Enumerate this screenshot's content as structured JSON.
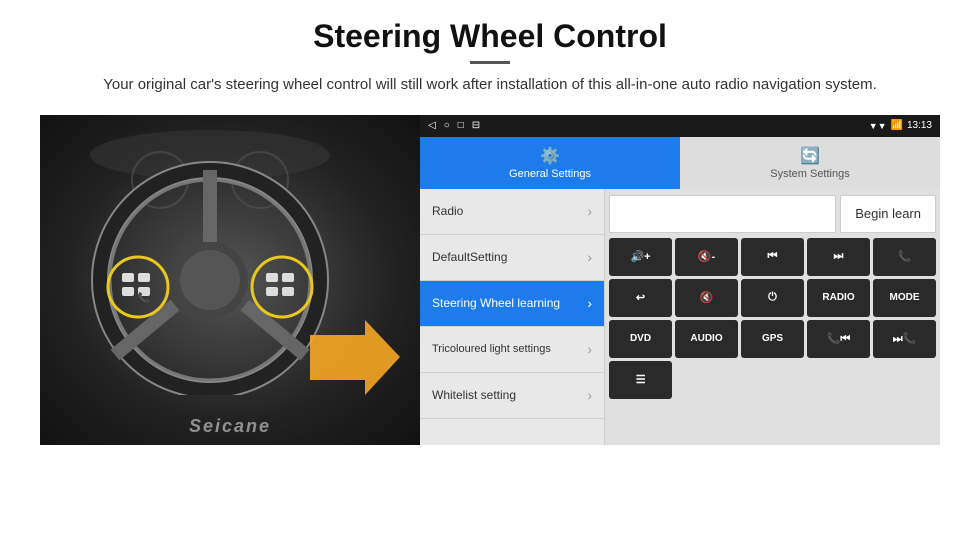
{
  "page": {
    "title": "Steering Wheel Control",
    "subtitle": "Your original car's steering wheel control will still work after installation of this all-in-one auto radio navigation system."
  },
  "status_bar": {
    "nav_back": "◁",
    "nav_home": "○",
    "nav_square": "□",
    "nav_menu": "⊟",
    "signal": "▼▼",
    "wifi": "wifi",
    "time": "13:13"
  },
  "tabs": [
    {
      "id": "general",
      "label": "General Settings",
      "active": true
    },
    {
      "id": "system",
      "label": "System Settings",
      "active": false
    }
  ],
  "menu_items": [
    {
      "id": "radio",
      "label": "Radio",
      "active": false
    },
    {
      "id": "default",
      "label": "DefaultSetting",
      "active": false
    },
    {
      "id": "steering",
      "label": "Steering Wheel learning",
      "active": true
    },
    {
      "id": "tricoloured",
      "label": "Tricoloured light settings",
      "active": false
    },
    {
      "id": "whitelist",
      "label": "Whitelist setting",
      "active": false
    }
  ],
  "controls": {
    "begin_learn_label": "Begin learn",
    "buttons_row1": [
      {
        "id": "vol-up",
        "label": "🔊+",
        "symbol": "🔊+"
      },
      {
        "id": "vol-down",
        "label": "🔇-",
        "symbol": "🔇-"
      },
      {
        "id": "prev",
        "label": "⏮",
        "symbol": "⏮"
      },
      {
        "id": "next",
        "label": "⏭",
        "symbol": "⏭"
      },
      {
        "id": "phone",
        "label": "📞",
        "symbol": "📞"
      }
    ],
    "buttons_row2": [
      {
        "id": "hang-up",
        "label": "↩",
        "symbol": "↩"
      },
      {
        "id": "mute",
        "label": "🔇x",
        "symbol": "🔇"
      },
      {
        "id": "power",
        "label": "⏻",
        "symbol": "⏻"
      },
      {
        "id": "radio",
        "label": "RADIO",
        "symbol": "RADIO"
      },
      {
        "id": "mode",
        "label": "MODE",
        "symbol": "MODE"
      }
    ],
    "buttons_row3": [
      {
        "id": "dvd",
        "label": "DVD",
        "symbol": "DVD"
      },
      {
        "id": "audio",
        "label": "AUDIO",
        "symbol": "AUDIO"
      },
      {
        "id": "gps",
        "label": "GPS",
        "symbol": "GPS"
      },
      {
        "id": "tel-prev",
        "label": "📞⏮",
        "symbol": "📞⏮"
      },
      {
        "id": "tel-next",
        "label": "⏭📞",
        "symbol": "⏭📞"
      }
    ],
    "buttons_row4": [
      {
        "id": "menu-icon",
        "label": "☰",
        "symbol": "☰"
      }
    ]
  },
  "image": {
    "seicane_logo": "Seicane"
  }
}
